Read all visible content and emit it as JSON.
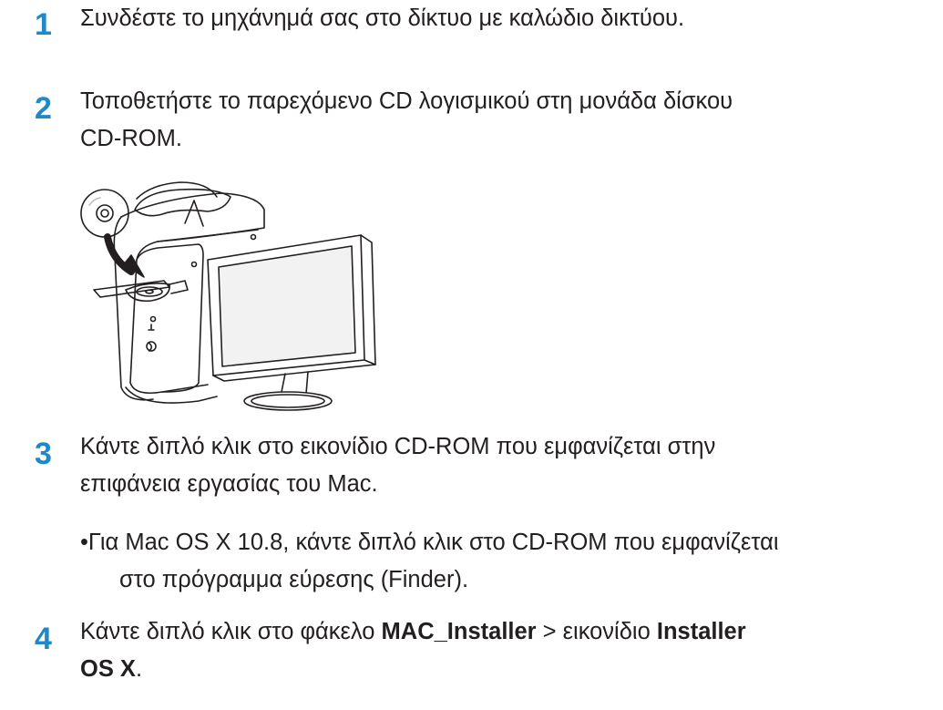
{
  "steps": [
    {
      "number": "1",
      "text": "Συνδέστε το μηχάνημά σας στο δίκτυο με καλώδιο δικτύου."
    },
    {
      "number": "2",
      "line1": "Τοποθετήστε το παρεχόμενο CD λογισμικού στη μονάδα δίσκου",
      "line2": "CD-ROM."
    },
    {
      "number": "3",
      "line1": "Κάντε διπλό κλικ στο εικονίδιο CD-ROM που εμφανίζεται στην",
      "line2": "επιφάνεια εργασίας του Mac.",
      "sub_line1": "•Για Mac OS X 10.8, κάντε διπλό κλικ στο CD-ROM που εμφανίζεται",
      "sub_line2": "στο πρόγραμμα εύρεσης (Finder)."
    },
    {
      "number": "4",
      "pre": "Κάντε διπλό κλικ στο φάκελο ",
      "bold1": "MAC_Installer",
      "mid": " > εικονίδιο ",
      "bold2": "Installer",
      "bold3": "OS X",
      "end": "."
    }
  ],
  "colors": {
    "step_number": "#1e88c8",
    "text": "#231f20"
  },
  "illustration": "mac-pro-cd-insert-illustration"
}
